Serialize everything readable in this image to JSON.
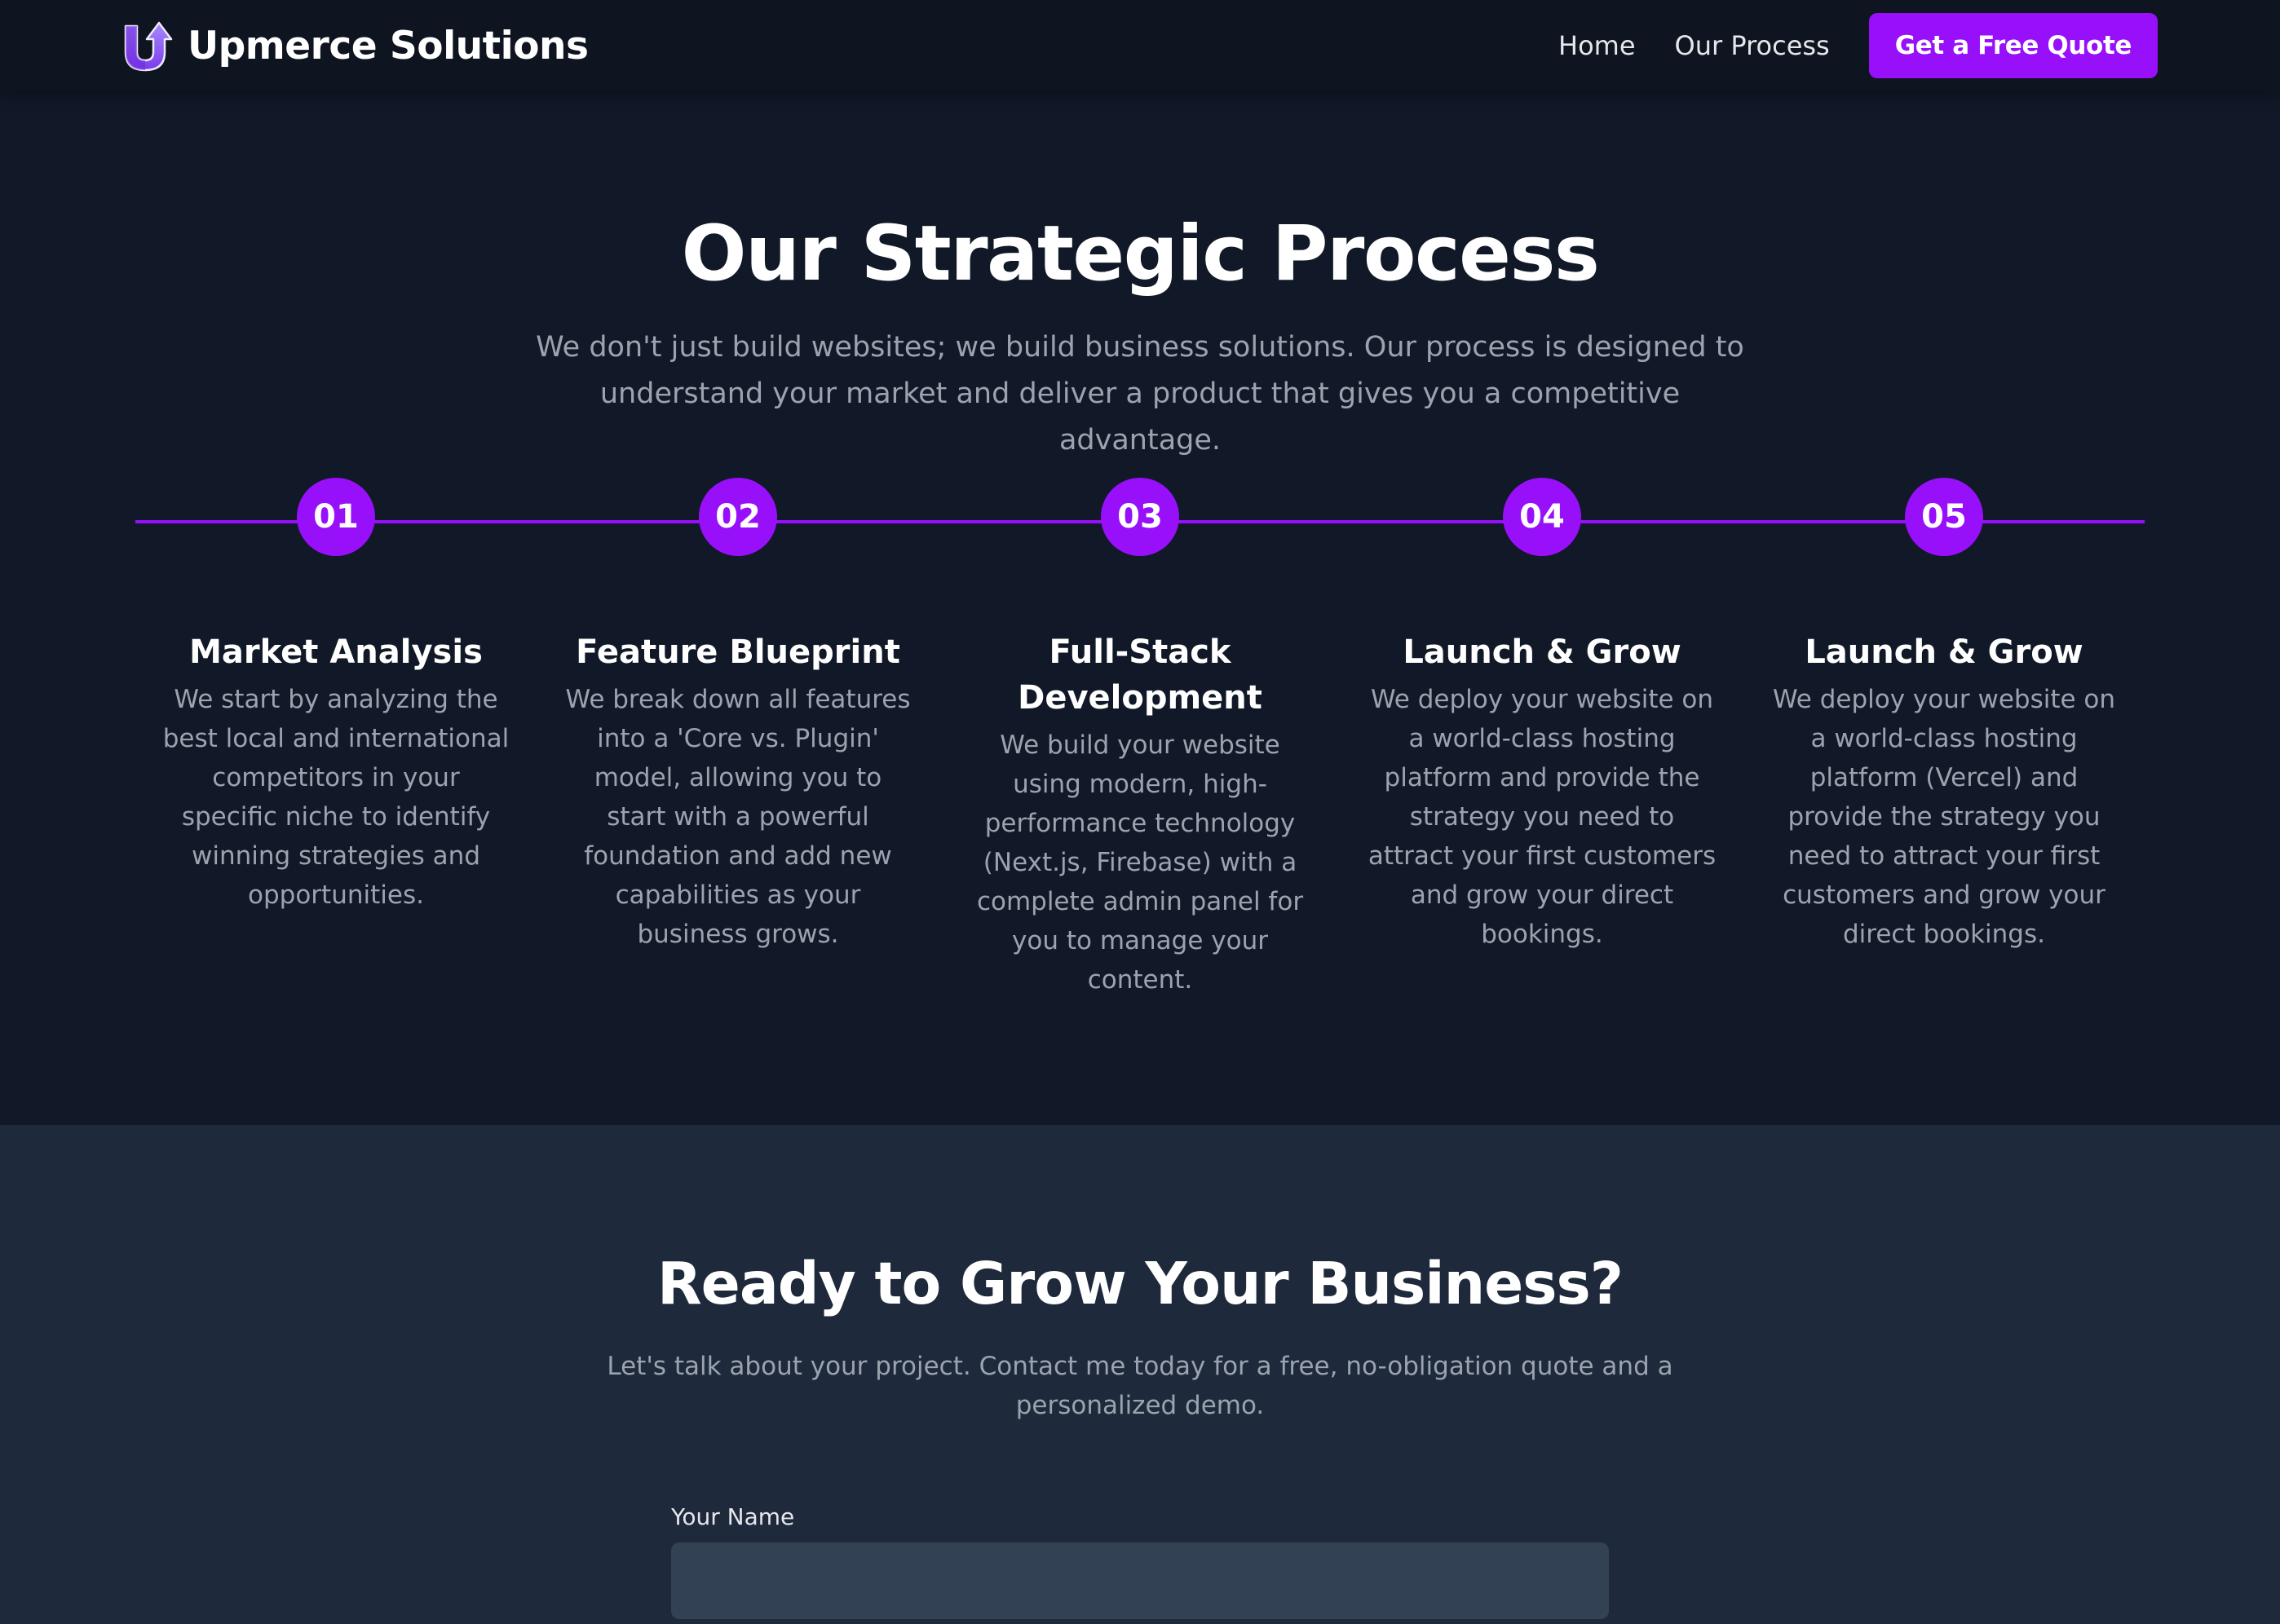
{
  "header": {
    "brand": "Upmerce Solutions",
    "nav": {
      "home": "Home",
      "process": "Our Process"
    },
    "cta": "Get a Free Quote"
  },
  "process": {
    "title": "Our Strategic Process",
    "subtitle": "We don't just build websites; we build business solutions. Our process is designed to understand your market and deliver a product that gives you a competitive advantage.",
    "steps": [
      {
        "number": "01",
        "title": "Market Analysis",
        "description": "We start by analyzing the best local and international competitors in your specific niche to identify winning strategies and opportunities."
      },
      {
        "number": "02",
        "title": "Feature Blueprint",
        "description": "We break down all features into a 'Core vs. Plugin' model, allowing you to start with a powerful foundation and add new capabilities as your business grows."
      },
      {
        "number": "03",
        "title": "Full-Stack Development",
        "description": "We build your website using modern, high-performance technology (Next.js, Firebase) with a complete admin panel for you to manage your content."
      },
      {
        "number": "04",
        "title": "Launch & Grow",
        "description": "We deploy your website on a world-class hosting platform and provide the strategy you need to attract your first customers and grow your direct bookings."
      },
      {
        "number": "05",
        "title": "Launch & Grow",
        "description": "We deploy your website on a world-class hosting platform (Vercel) and provide the strategy you need to attract your first customers and grow your direct bookings."
      }
    ]
  },
  "contact": {
    "title": "Ready to Grow Your Business?",
    "subtitle": "Let's talk about your project. Contact me today for a free, no-obligation quote and a personalized demo.",
    "name_label": "Your Name",
    "name_value": ""
  },
  "colors": {
    "accent": "#9810fa",
    "background_dark": "#111827",
    "background_contact": "#1e293b",
    "input_background": "#334155",
    "muted_text": "#9ca3af"
  }
}
